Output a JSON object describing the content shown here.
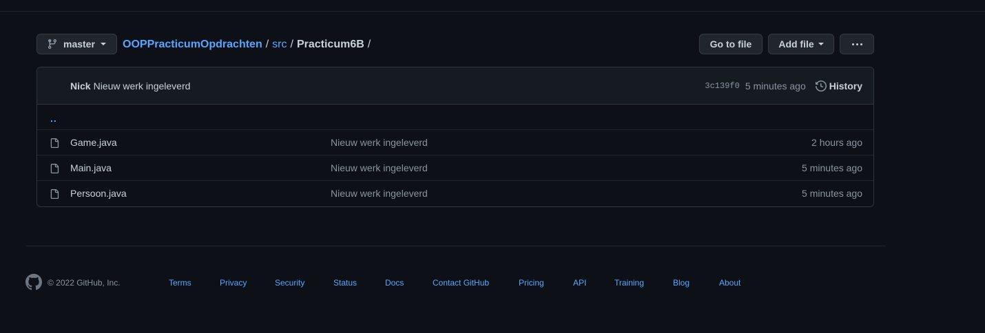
{
  "toolbar": {
    "branch_label": "master",
    "breadcrumb": {
      "repo": "OOPPracticumOpdrachten",
      "sep1": "/",
      "folder": "src",
      "sep2": "/",
      "current": "Practicum6B",
      "sep3": "/"
    },
    "goto_label": "Go to file",
    "addfile_label": "Add file"
  },
  "commit": {
    "author": "Nick",
    "message": "Nieuw werk ingeleverd",
    "sha": "3c139f0",
    "time": "5 minutes ago",
    "history_label": "History"
  },
  "files": {
    "up": "..",
    "rows": [
      {
        "name": "Game.java",
        "message": "Nieuw werk ingeleverd",
        "age": "2 hours ago"
      },
      {
        "name": "Main.java",
        "message": "Nieuw werk ingeleverd",
        "age": "5 minutes ago"
      },
      {
        "name": "Persoon.java",
        "message": "Nieuw werk ingeleverd",
        "age": "5 minutes ago"
      }
    ]
  },
  "footer": {
    "copyright": "© 2022 GitHub, Inc.",
    "links": [
      "Terms",
      "Privacy",
      "Security",
      "Status",
      "Docs",
      "Contact GitHub",
      "Pricing",
      "API",
      "Training",
      "Blog",
      "About"
    ]
  },
  "colors": {
    "background": "#0d1117",
    "link": "#58a6ff",
    "muted": "#8b949e",
    "text": "#c9d1d9"
  }
}
